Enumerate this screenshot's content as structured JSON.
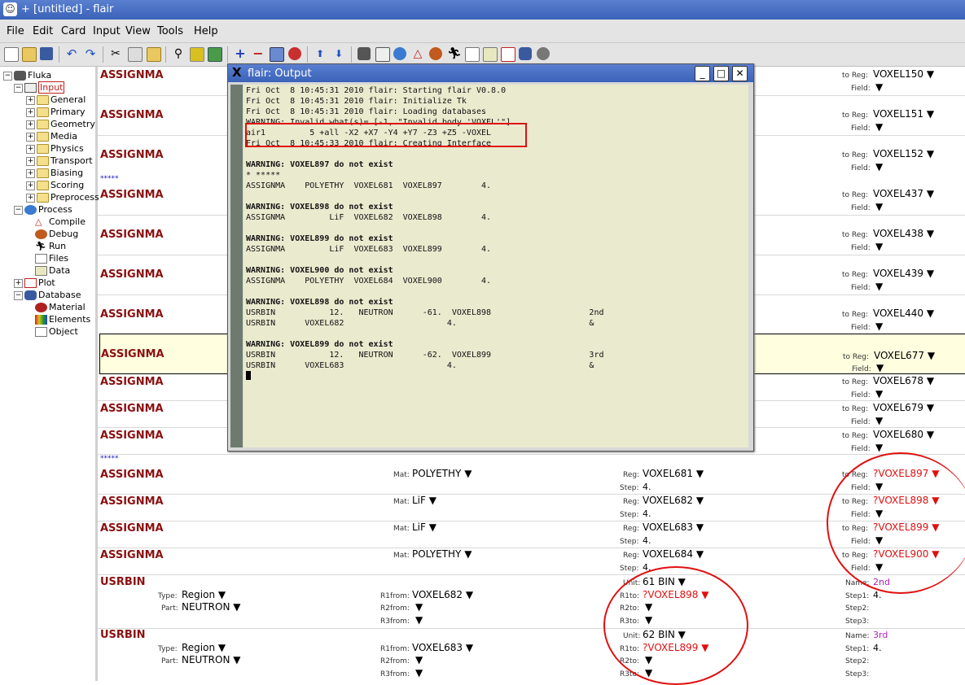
{
  "window": {
    "title": "+ [untitled] - flair"
  },
  "menu": [
    "File",
    "Edit",
    "Card",
    "Input",
    "View",
    "Tools",
    "Help"
  ],
  "tree": [
    {
      "label": "Fluka",
      "level": 0
    },
    {
      "label": "Input",
      "level": 1,
      "selected": true
    },
    {
      "label": "General",
      "level": 2
    },
    {
      "label": "Primary",
      "level": 2
    },
    {
      "label": "Geometry",
      "level": 2
    },
    {
      "label": "Media",
      "level": 2
    },
    {
      "label": "Physics",
      "level": 2
    },
    {
      "label": "Transport",
      "level": 2
    },
    {
      "label": "Biasing",
      "level": 2
    },
    {
      "label": "Scoring",
      "level": 2
    },
    {
      "label": "Preprocess",
      "level": 2
    },
    {
      "label": "Process",
      "level": 1
    },
    {
      "label": "Compile",
      "level": 2
    },
    {
      "label": "Debug",
      "level": 2
    },
    {
      "label": "Run",
      "level": 2
    },
    {
      "label": "Files",
      "level": 2
    },
    {
      "label": "Data",
      "level": 2
    },
    {
      "label": "Plot",
      "level": 1
    },
    {
      "label": "Database",
      "level": 1
    },
    {
      "label": "Material",
      "level": 2
    },
    {
      "label": "Elements",
      "level": 2
    },
    {
      "label": "Object",
      "level": 2
    }
  ],
  "labels": {
    "to_reg": "to Reg:",
    "field": "Field:",
    "mat": "Mat:",
    "reg": "Reg:",
    "step": "Step:",
    "type": "Type:",
    "part": "Part:",
    "r1from": "R1from:",
    "r2from": "R2from:",
    "r3from": "R3from:",
    "unit": "Unit:",
    "r1to": "R1to:",
    "r2to": "R2to:",
    "r3to": "R3to:",
    "name": "Name:",
    "step1": "Step1:",
    "step2": "Step2:",
    "step3": "Step3:",
    "dropdown": "▼",
    "stars": "*****"
  },
  "cards": {
    "assignma_top": [
      {
        "name": "ASSIGNMA",
        "to_reg": "VOXEL150"
      },
      {
        "name": "ASSIGNMA",
        "to_reg": "VOXEL151"
      },
      {
        "name": "ASSIGNMA",
        "to_reg": "VOXEL152"
      },
      {
        "name": "ASSIGNMA",
        "to_reg": "VOXEL437"
      },
      {
        "name": "ASSIGNMA",
        "to_reg": "VOXEL438"
      },
      {
        "name": "ASSIGNMA",
        "to_reg": "VOXEL439"
      },
      {
        "name": "ASSIGNMA",
        "to_reg": "VOXEL440"
      },
      {
        "name": "ASSIGNMA",
        "to_reg": "VOXEL677"
      },
      {
        "name": "ASSIGNMA",
        "to_reg": "VOXEL678"
      },
      {
        "name": "ASSIGNMA",
        "to_reg": "VOXEL679"
      },
      {
        "name": "ASSIGNMA",
        "to_reg": "VOXEL680"
      }
    ],
    "assignma_bottom": [
      {
        "name": "ASSIGNMA",
        "mat": "POLYETHY",
        "reg": "VOXEL681",
        "step": "4.",
        "to_reg": "?VOXEL897"
      },
      {
        "name": "ASSIGNMA",
        "mat": "LiF",
        "reg": "VOXEL682",
        "step": "4.",
        "to_reg": "?VOXEL898"
      },
      {
        "name": "ASSIGNMA",
        "mat": "LiF",
        "reg": "VOXEL683",
        "step": "4.",
        "to_reg": "?VOXEL899"
      },
      {
        "name": "ASSIGNMA",
        "mat": "POLYETHY",
        "reg": "VOXEL684",
        "step": "4.",
        "to_reg": "?VOXEL900"
      }
    ],
    "usrbin": [
      {
        "name": "USRBIN",
        "type": "Region",
        "part": "NEUTRON",
        "r1from": "VOXEL682",
        "unit": "61 BIN",
        "r1to": "?VOXEL898",
        "binname": "2nd",
        "step1": "4."
      },
      {
        "name": "USRBIN",
        "type": "Region",
        "part": "NEUTRON",
        "r1from": "VOXEL683",
        "unit": "62 BIN",
        "r1to": "?VOXEL899",
        "binname": "3rd",
        "step1": "4."
      }
    ],
    "partial_step_value": "4."
  },
  "output": {
    "title": "flair: Output",
    "lines": [
      {
        "t": "Fri Oct  8 10:45:31 2010 flair: Starting flair V0.8.0"
      },
      {
        "t": "Fri Oct  8 10:45:31 2010 flair: Initialize Tk"
      },
      {
        "t": "Fri Oct  8 10:45:31 2010 flair: Loading databases"
      },
      {
        "t": "WARNING: Invalid what(s)= [-1, \"Invalid body 'VOXEL'\"]"
      },
      {
        "t": "air1         5 +all -X2 +X7 -Y4 +Y7 -Z3 +Z5 -VOXEL"
      },
      {
        "t": "Fri Oct  8 10:45:33 2010 flair: Creating Interface"
      },
      {
        "t": ""
      },
      {
        "t": "WARNING: VOXEL897 do not exist",
        "b": true
      },
      {
        "t": "* *****"
      },
      {
        "t": "ASSIGNMA    POLYETHY  VOXEL681  VOXEL897        4."
      },
      {
        "t": ""
      },
      {
        "t": "WARNING: VOXEL898 do not exist",
        "b": true
      },
      {
        "t": "ASSIGNMA         LiF  VOXEL682  VOXEL898        4."
      },
      {
        "t": ""
      },
      {
        "t": "WARNING: VOXEL899 do not exist",
        "b": true
      },
      {
        "t": "ASSIGNMA         LiF  VOXEL683  VOXEL899        4."
      },
      {
        "t": ""
      },
      {
        "t": "WARNING: VOXEL900 do not exist",
        "b": true
      },
      {
        "t": "ASSIGNMA    POLYETHY  VOXEL684  VOXEL900        4."
      },
      {
        "t": ""
      },
      {
        "t": "WARNING: VOXEL898 do not exist",
        "b": true
      },
      {
        "t": "USRBIN           12.   NEUTRON      -61.  VOXEL898                    2nd"
      },
      {
        "t": "USRBIN      VOXEL682                     4.                           &"
      },
      {
        "t": ""
      },
      {
        "t": "WARNING: VOXEL899 do not exist",
        "b": true
      },
      {
        "t": "USRBIN           12.   NEUTRON      -62.  VOXEL899                    3rd"
      },
      {
        "t": "USRBIN      VOXEL683                     4.                           &"
      }
    ]
  },
  "colors": {
    "card_name": "#8b1010",
    "error": "#e01010",
    "highlight_row": "#ffffe0",
    "console_bg": "#eaeacf",
    "title_bar": "#3a62b8"
  }
}
